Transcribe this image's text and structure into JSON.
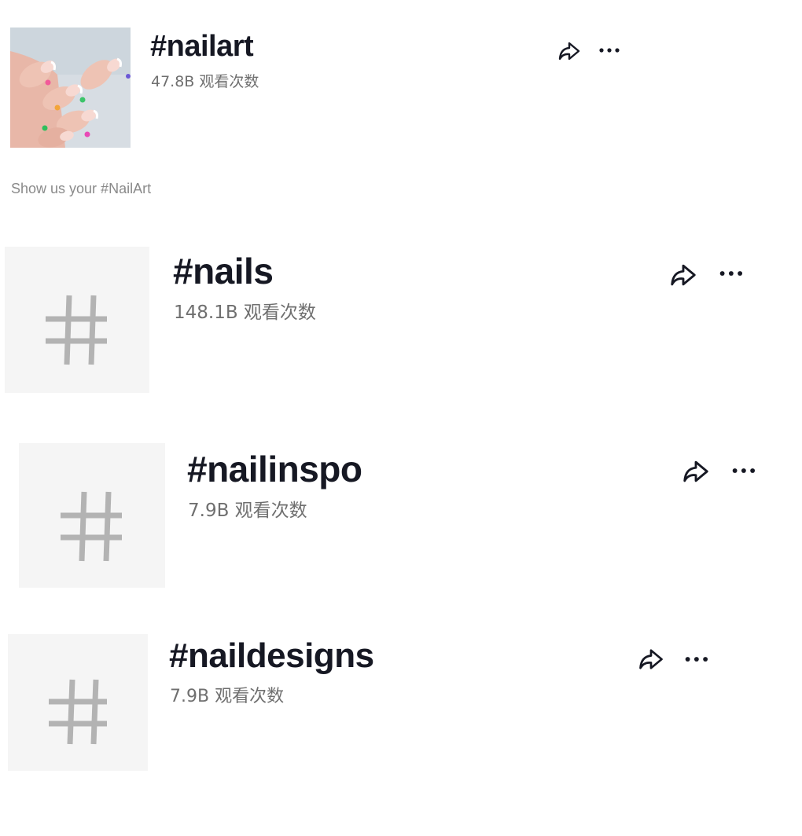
{
  "results": [
    {
      "title": "#nailart",
      "views": "47.8B 观看次数",
      "description": "Show us your #NailArt",
      "thumbnail": "photo-of-manicured-nails",
      "icons": {
        "share": "share-icon",
        "more": "more-icon"
      }
    },
    {
      "title": "#nails",
      "views": "148.1B 观看次数",
      "thumbnail": "hashtag-icon",
      "icons": {
        "share": "share-icon",
        "more": "more-icon"
      }
    },
    {
      "title": "#nailinspo",
      "views": "7.9B 观看次数",
      "thumbnail": "hashtag-icon",
      "icons": {
        "share": "share-icon",
        "more": "more-icon"
      }
    },
    {
      "title": "#naildesigns",
      "views": "7.9B 观看次数",
      "thumbnail": "hashtag-icon",
      "icons": {
        "share": "share-icon",
        "more": "more-icon"
      }
    }
  ],
  "colors": {
    "title": "#161823",
    "views": "#6f6f6f",
    "description": "#8a8a8a",
    "placeholder_bg": "#f5f5f5",
    "hash_glyph": "#b3b3b3"
  }
}
